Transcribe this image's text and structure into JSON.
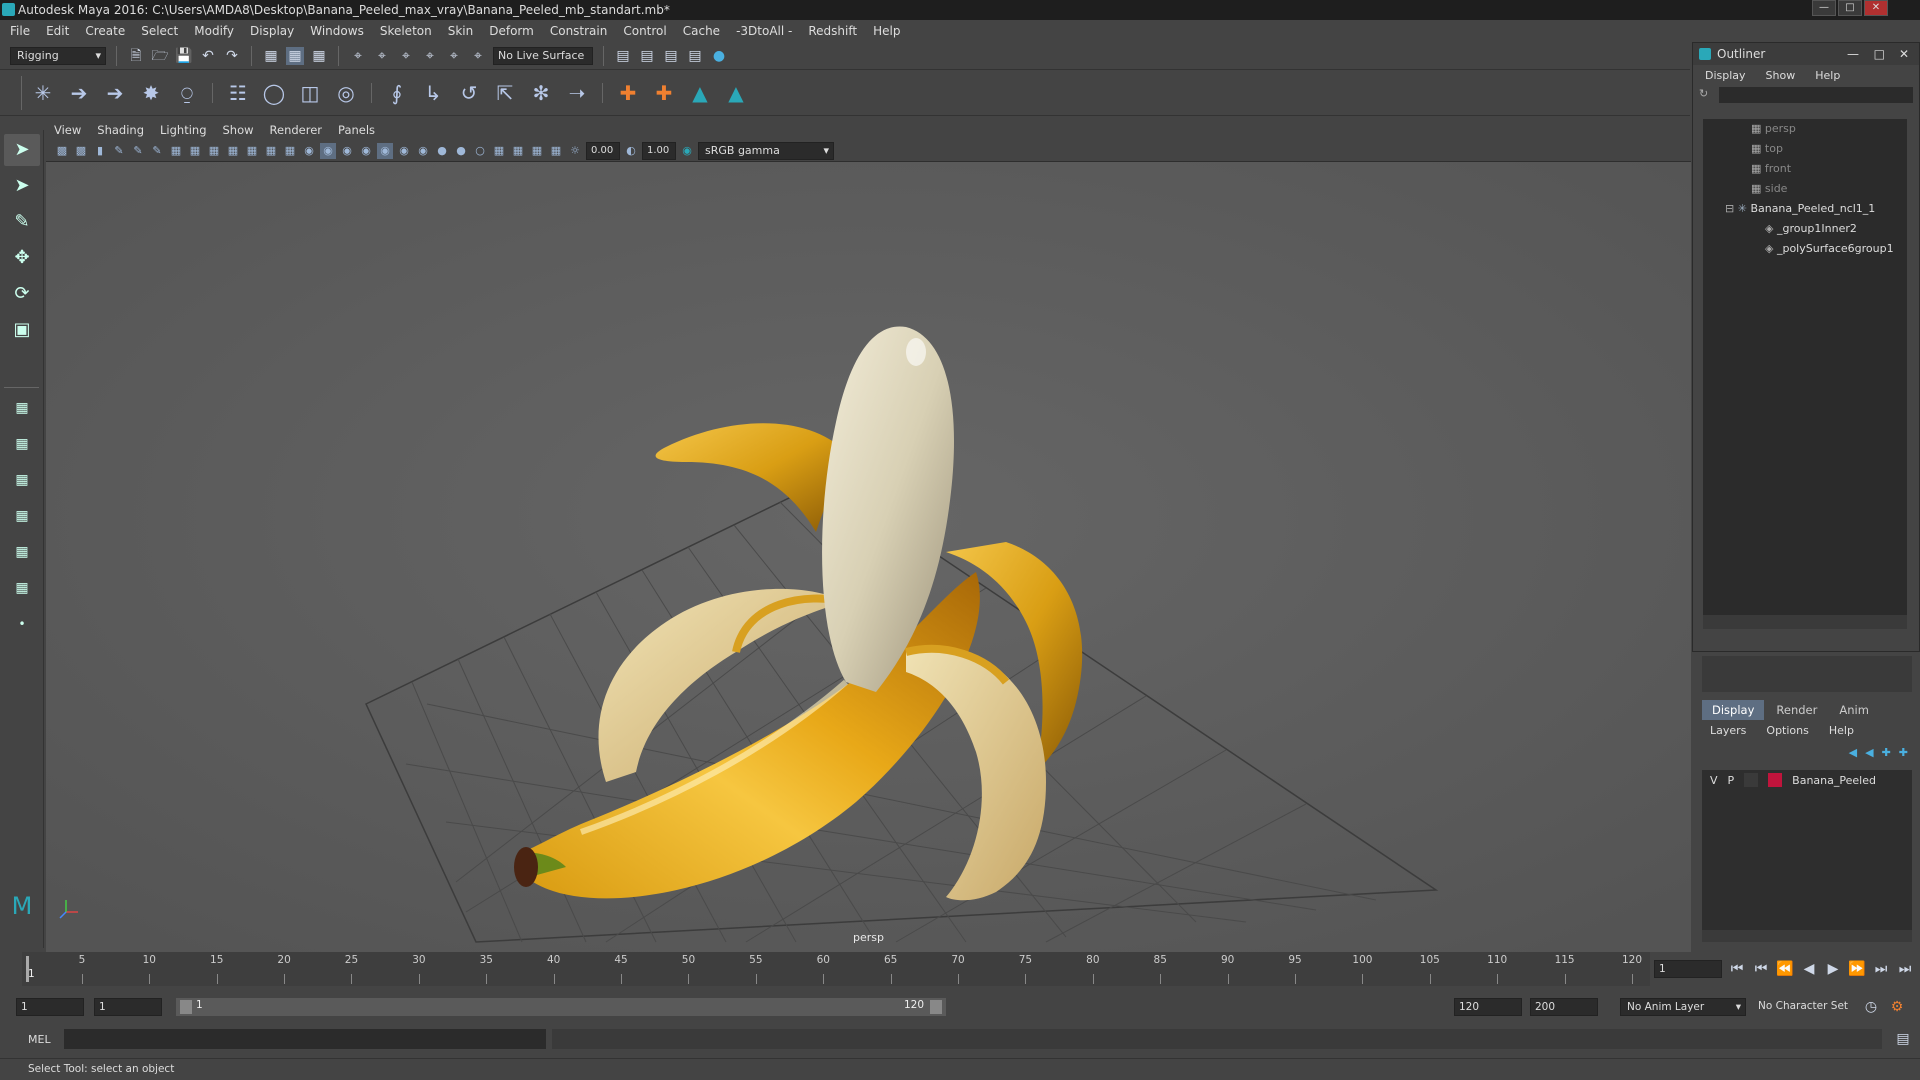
{
  "title": "Autodesk Maya 2016: C:\\Users\\AMDA8\\Desktop\\Banana_Peeled_max_vray\\Banana_Peeled_mb_standart.mb*",
  "menus": [
    "File",
    "Edit",
    "Create",
    "Select",
    "Modify",
    "Display",
    "Windows",
    "Skeleton",
    "Skin",
    "Deform",
    "Constrain",
    "Control",
    "Cache",
    "-3DtoAll -",
    "Redshift",
    "Help"
  ],
  "status": {
    "menuset": "Rigging",
    "live_surface": "No Live Surface"
  },
  "panel_menus": [
    "View",
    "Shading",
    "Lighting",
    "Show",
    "Renderer",
    "Panels"
  ],
  "panel_toolbar": {
    "exposure": "0.00",
    "gamma": "1.00",
    "color_space": "sRGB gamma"
  },
  "viewport": {
    "camera": "persp"
  },
  "outliner": {
    "title": "Outliner",
    "menus": [
      "Display",
      "Show",
      "Help"
    ],
    "items": [
      {
        "label": "persp",
        "dim": true
      },
      {
        "label": "top",
        "dim": true
      },
      {
        "label": "front",
        "dim": true
      },
      {
        "label": "side",
        "dim": true
      },
      {
        "label": "Banana_Peeled_ncl1_1",
        "dim": false
      },
      {
        "label": "_group1Inner2",
        "dim": false
      },
      {
        "label": "_polySurface6group1",
        "dim": false
      }
    ]
  },
  "layers": {
    "tabs": [
      "Display",
      "Render",
      "Anim"
    ],
    "menus": [
      "Layers",
      "Options",
      "Help"
    ],
    "rows": [
      {
        "v": "V",
        "p": "P",
        "name": "Banana_Peeled",
        "color": "#c0143c"
      }
    ]
  },
  "timeline": {
    "ticks": [
      "5",
      "10",
      "15",
      "20",
      "25",
      "30",
      "35",
      "40",
      "45",
      "50",
      "55",
      "60",
      "65",
      "70",
      "75",
      "80",
      "85",
      "90",
      "95",
      "100",
      "105",
      "110",
      "115",
      "120"
    ],
    "start_label": "1",
    "current_frame": "1"
  },
  "range": {
    "start": "1",
    "anim_start": "1",
    "slider_start": "1",
    "slider_end": "120",
    "end": "120",
    "anim_end": "200",
    "anim_layer": "No Anim Layer",
    "character_set": "No Character Set"
  },
  "command": {
    "label": "MEL"
  },
  "help_line": "Select Tool: select an object",
  "colors": {
    "accent": "#5e6e82",
    "layer": "#c0143c",
    "maya_teal": "#2aa8b8"
  }
}
